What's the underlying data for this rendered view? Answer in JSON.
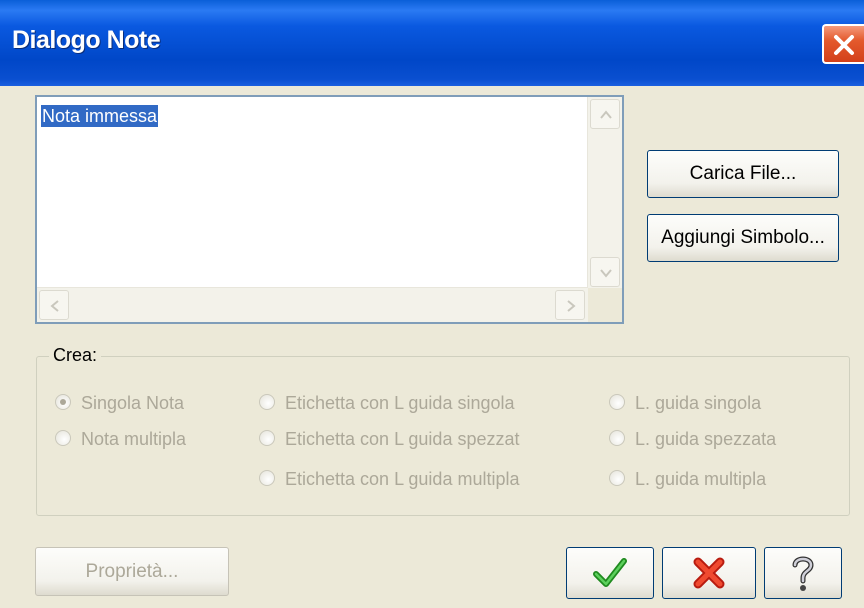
{
  "window": {
    "title": "Dialogo Note",
    "close_icon": "close-icon"
  },
  "note": {
    "text": "Nota immessa"
  },
  "buttons": {
    "carica_file": "Carica File...",
    "aggiungi_simbolo": "Aggiungi Simbolo...",
    "proprieta": "Proprietà...",
    "ok_icon": "checkmark-icon",
    "cancel_icon": "x-icon",
    "help_icon": "question-mark-icon"
  },
  "crea": {
    "label": "Crea:",
    "options": [
      {
        "label": "Singola Nota",
        "selected": true
      },
      {
        "label": "Nota multipla",
        "selected": false
      },
      {
        "label": "Etichetta con L guida singola",
        "selected": false
      },
      {
        "label": "Etichetta con L guida spezzat",
        "selected": false
      },
      {
        "label": "Etichetta con L guida multipla",
        "selected": false
      },
      {
        "label": "L. guida singola",
        "selected": false
      },
      {
        "label": "L. guida spezzata",
        "selected": false
      },
      {
        "label": "L. guida multipla",
        "selected": false
      }
    ],
    "disabled": true
  },
  "colors": {
    "title_bar": "#0a4fd0",
    "selection": "#316ac5",
    "ok_green": "#2fa22f",
    "cancel_red": "#e0301e",
    "disabled_text": "#aca899"
  }
}
